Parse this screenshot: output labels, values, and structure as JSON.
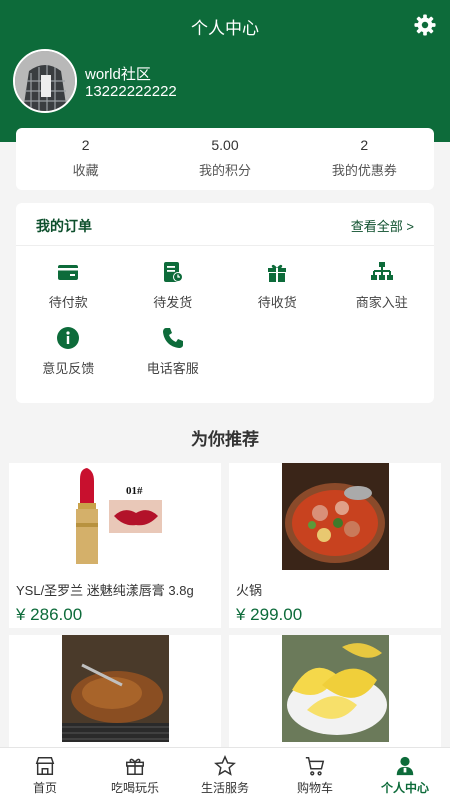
{
  "header": {
    "title": "个人中心"
  },
  "user": {
    "name": "world社区",
    "phone": "13222222222"
  },
  "stats": [
    {
      "value": "2",
      "label": "收藏"
    },
    {
      "value": "5.00",
      "label": "我的积分"
    },
    {
      "value": "2",
      "label": "我的优惠券"
    }
  ],
  "orders": {
    "title": "我的订单",
    "view_all": "查看全部 >",
    "items": [
      {
        "label": "待付款",
        "icon": "wallet-icon"
      },
      {
        "label": "待发货",
        "icon": "receipt-clock-icon"
      },
      {
        "label": "待收货",
        "icon": "gift-icon"
      },
      {
        "label": "商家入驻",
        "icon": "sitemap-icon"
      },
      {
        "label": "意见反馈",
        "icon": "info-icon"
      },
      {
        "label": "电话客服",
        "icon": "phone-icon"
      }
    ]
  },
  "recommend": {
    "title": "为你推荐",
    "products": [
      {
        "name": "YSL/圣罗兰 迷魅纯漾唇膏 3.8g",
        "price": "¥ 286.00",
        "image_caption": "01#"
      },
      {
        "name": "火锅",
        "price": "¥ 299.00"
      },
      {
        "name": "",
        "price": ""
      },
      {
        "name": "",
        "price": ""
      }
    ]
  },
  "tabbar": {
    "items": [
      {
        "label": "首页",
        "icon": "store-icon"
      },
      {
        "label": "吃喝玩乐",
        "icon": "gift-icon"
      },
      {
        "label": "生活服务",
        "icon": "star-icon"
      },
      {
        "label": "购物车",
        "icon": "cart-icon"
      },
      {
        "label": "个人中心",
        "icon": "user-icon"
      }
    ],
    "active_index": 4
  },
  "colors": {
    "brand": "#0d6b3a",
    "background": "#f4f4f4"
  }
}
